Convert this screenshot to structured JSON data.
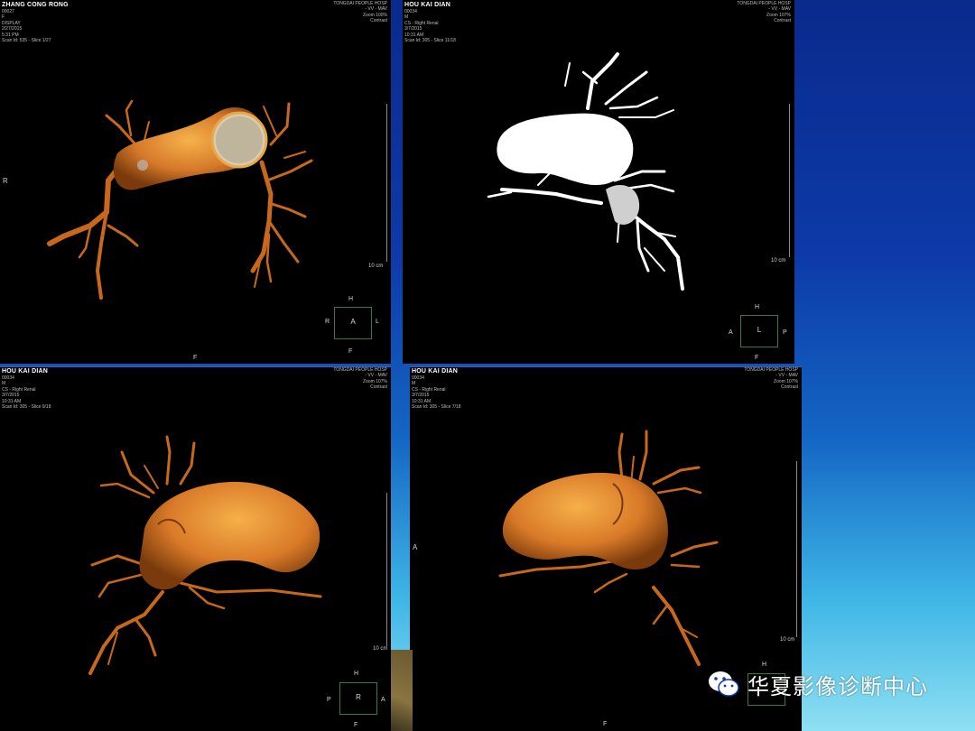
{
  "panels": [
    {
      "patient": "ZHANG CONG RONG",
      "lines": [
        "00027",
        "F",
        "DISPLAY",
        "2/27/2015",
        "5:31 PM",
        "Scan Id: 535 - Slice 1/27"
      ],
      "hospital": "TONGDAI PEOPLE HOSP",
      "hosp_lines": [
        "- VV - MAV",
        "Zoom 100%",
        "Contrast"
      ],
      "scale": "10 cm",
      "side": "R",
      "orient": {
        "center": "A",
        "top": "H",
        "left": "R",
        "right": "L",
        "bottom": "F"
      },
      "bottom_label": "F"
    },
    {
      "patient": "HOU KAI DIAN",
      "lines": [
        "00034",
        "M",
        "CS - Right Renal",
        "3/7/2015",
        "10:31 AM",
        "Scan Id: 305 - Slice 11/18"
      ],
      "hospital": "TONGDAI PEOPLE HOSP",
      "hosp_lines": [
        "- VV - MAV",
        "Zoom 107%",
        "Contrast"
      ],
      "scale": "10 cm",
      "orient": {
        "center": "L",
        "top": "H",
        "left": "A",
        "right": "P",
        "bottom": "F"
      }
    },
    {
      "patient": "HOU KAI DIAN",
      "lines": [
        "00034",
        "M",
        "CS - Right Renal",
        "3/7/2015",
        "10:31 AM",
        "Scan Id: 305 - Slice 9/18"
      ],
      "hospital": "TONGDAI PEOPLE HOSP",
      "hosp_lines": [
        "- VV - MAV",
        "Zoom 107%",
        "Contrast"
      ],
      "scale": "10 cm",
      "orient": {
        "center": "R",
        "top": "H",
        "left": "P",
        "right": "A",
        "bottom": "F"
      }
    },
    {
      "patient": "HOU KAI DIAN",
      "lines": [
        "00034",
        "M",
        "CS - Right Renal",
        "3/7/2015",
        "10:31 AM",
        "Scan Id: 305 - Slice 7/18"
      ],
      "hospital": "TONGDAI PEOPLE HOSP",
      "hosp_lines": [
        "- VV - MAV",
        "Zoom 107%",
        "Contrast"
      ],
      "scale": "10 cm",
      "side": "A",
      "orient": {
        "top": "H"
      },
      "bottom_label": "F"
    }
  ],
  "watermark": {
    "text": "华夏影像诊断中心",
    "icon": "wechat-icon"
  },
  "colors": {
    "vessel": "#c8681a",
    "vessel_light": "#f0a040",
    "mip": "#ffffff",
    "frame": "#3c7a3c"
  }
}
